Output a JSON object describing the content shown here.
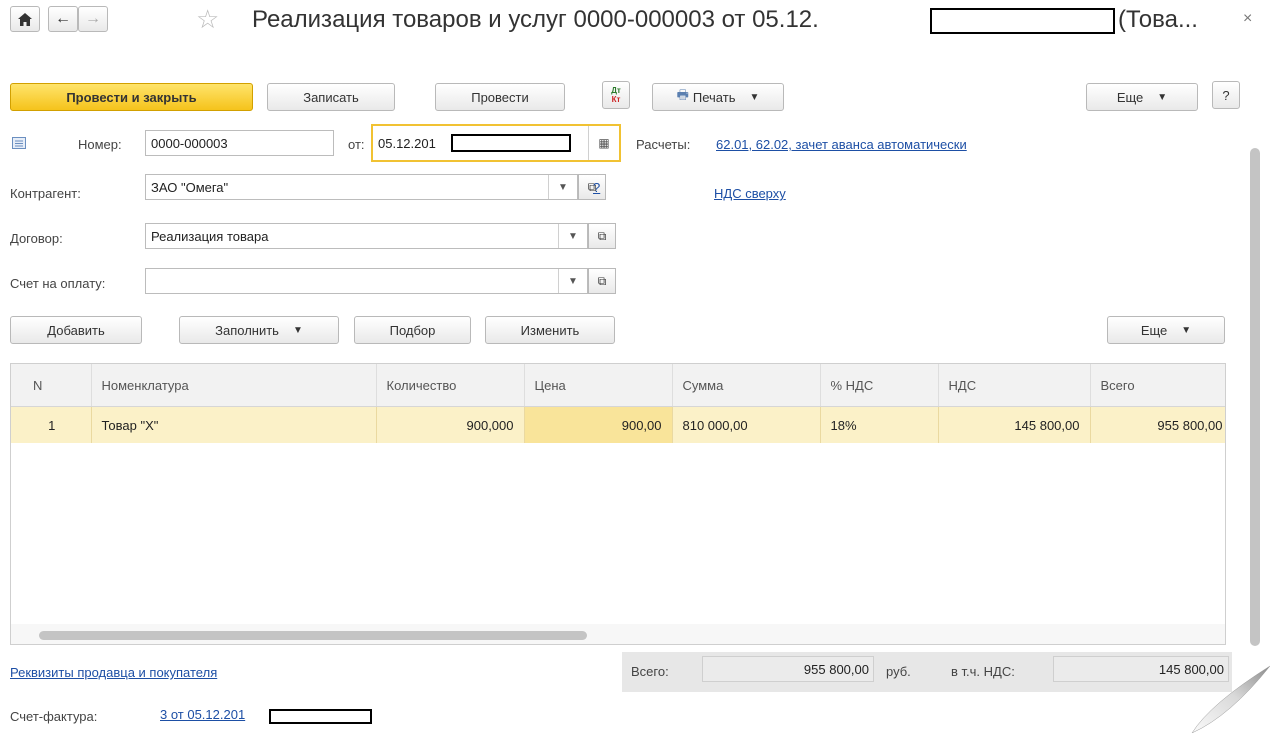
{
  "title": "Реализация товаров и услуг 0000-000003 от 05.12.",
  "title_suffix": "(Това...",
  "close": "×",
  "icons": {
    "home": "home-icon",
    "back": "arrow-left-icon",
    "forward": "arrow-right-icon",
    "star": "star-icon"
  },
  "toolbar": {
    "post_close": "Провести и закрыть",
    "save": "Записать",
    "post": "Провести",
    "dt_kt": "Дт Кт",
    "print": "Печать",
    "more": "Еще",
    "help": "?"
  },
  "form": {
    "number_label": "Номер:",
    "number_value": "0000-000003",
    "date_label": "от:",
    "date_value": "05.12.201",
    "payments_label": "Расчеты:",
    "payments_link": "62.01, 62.02, зачет аванса автоматически",
    "counterparty_label": "Контрагент:",
    "counterparty_value": "ЗАО \"Омега\"",
    "question": "?",
    "vat_link": "НДС сверху",
    "contract_label": "Договор:",
    "contract_value": "Реализация товара",
    "invoice_label": "Счет на оплату:",
    "invoice_value": ""
  },
  "table_toolbar": {
    "add": "Добавить",
    "fill": "Заполнить",
    "pick": "Подбор",
    "change": "Изменить",
    "more": "Еще"
  },
  "table": {
    "columns": [
      "N",
      "Номенклатура",
      "Количество",
      "Цена",
      "Сумма",
      "% НДС",
      "НДС",
      "Всего"
    ],
    "rows": [
      {
        "n": "1",
        "item": "Товар \"Х\"",
        "qty": "900,000",
        "price": "900,00",
        "sum": "810 000,00",
        "vat_rate": "18%",
        "vat": "145 800,00",
        "total": "955 800,00"
      }
    ]
  },
  "footer": {
    "requisites_link": "Реквизиты продавца и покупателя",
    "total_label": "Всего:",
    "total_value": "955 800,00",
    "currency": "руб.",
    "vat_label": "в т.ч. НДС:",
    "vat_value": "145 800,00",
    "invoice_label": "Счет-фактура:",
    "invoice_link": "3 от 05.12.201"
  }
}
